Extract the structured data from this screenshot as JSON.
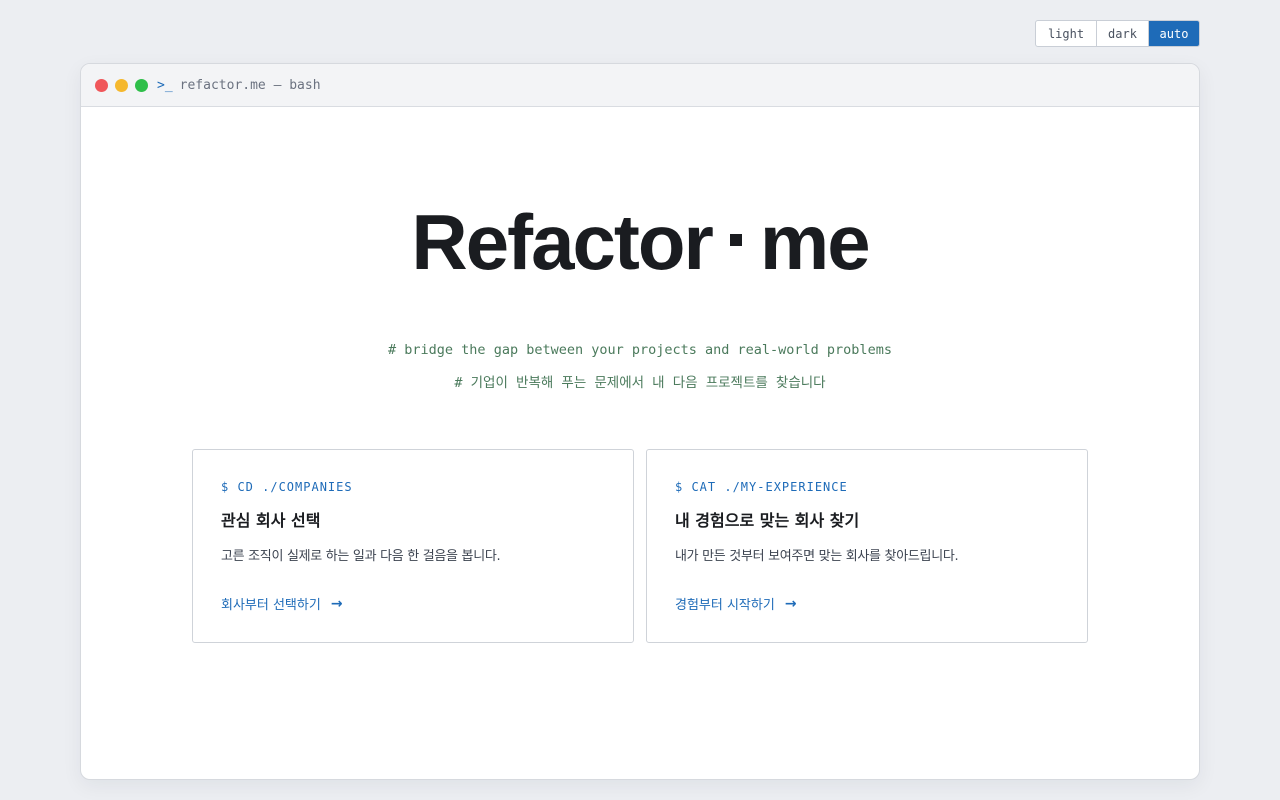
{
  "theme_toggle": {
    "light": "light",
    "dark": "dark",
    "auto": "auto",
    "selected": "auto"
  },
  "window": {
    "prompt_icon": ">_",
    "title": "refactor.me — bash"
  },
  "hero": {
    "title_left": "Refactor",
    "title_right": "me",
    "subtitle_en": "# bridge the gap between your projects and real-world problems",
    "subtitle_ko": "# 기업이 반복해 푸는 문제에서 내 다음 프로젝트를 찾습니다"
  },
  "cards": [
    {
      "command": "$ CD ./COMPANIES",
      "title": "관심 회사 선택",
      "description": "고른 조직이 실제로 하는 일과 다음 한 걸음을 봅니다.",
      "link": "회사부터 선택하기",
      "arrow": "→"
    },
    {
      "command": "$ CAT ./MY-EXPERIENCE",
      "title": "내 경험으로 맞는 회사 찾기",
      "description": "내가 만든 것부터 보여주면 맞는 회사를 찾아드립니다.",
      "link": "경험부터 시작하기",
      "arrow": "→"
    }
  ],
  "colors": {
    "accent": "#1e6bb8",
    "subtitle": "#4b7a5c",
    "background": "#eceef2"
  }
}
